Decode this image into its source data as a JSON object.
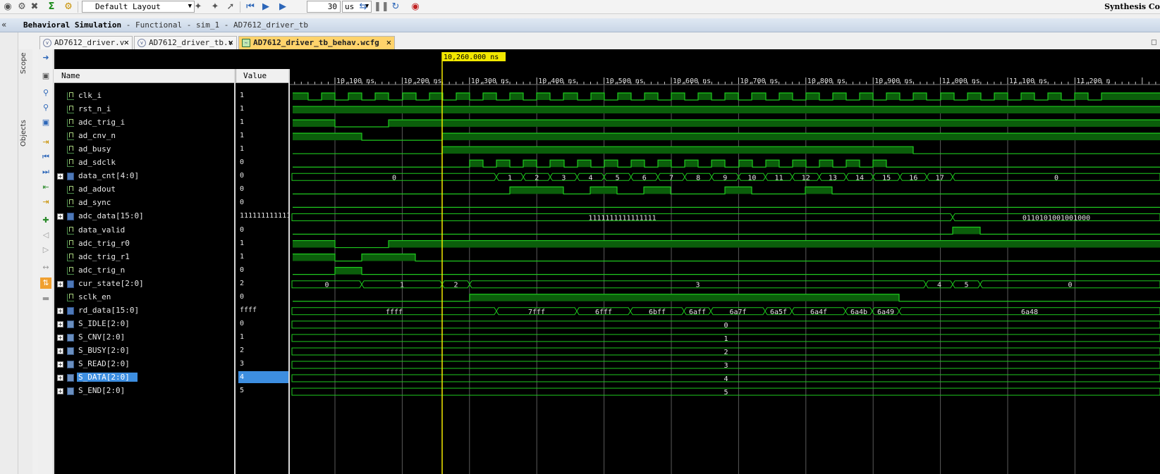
{
  "toolbar": {
    "layout": "Default Layout",
    "run_time": "30",
    "run_unit": "us",
    "right_label": "Synthesis Co"
  },
  "title_bar": {
    "title": "Behavioral Simulation",
    "subtitle": " - Functional - sim_1 - AD7612_driver_tb"
  },
  "side_tabs": [
    "Scope",
    "Objects"
  ],
  "tabs": [
    {
      "label": "AD7612_driver.v"
    },
    {
      "label": "AD7612_driver_tb.v"
    },
    {
      "label": "AD7612_driver_tb_behav.wcfg"
    }
  ],
  "waveform": {
    "name_header": "Name",
    "value_header": "Value",
    "cursor_time": "10,260.000 ns",
    "time_ticks": [
      "10,100 ns",
      "10,200 ns",
      "10,300 ns",
      "10,400 ns",
      "10,500 ns",
      "10,600 ns",
      "10,700 ns",
      "10,800 ns",
      "10,900 ns",
      "11,000 ns",
      "11,100 ns",
      "11,200 n"
    ],
    "signals": [
      {
        "name": "clk_i",
        "value": "1",
        "kind": "bit",
        "expand": false
      },
      {
        "name": "rst_n_i",
        "value": "1",
        "kind": "bit",
        "expand": false
      },
      {
        "name": "adc_trig_i",
        "value": "1",
        "kind": "bit",
        "expand": false
      },
      {
        "name": "ad_cnv_n",
        "value": "1",
        "kind": "bit",
        "expand": false
      },
      {
        "name": "ad_busy",
        "value": "1",
        "kind": "bit",
        "expand": false
      },
      {
        "name": "ad_sdclk",
        "value": "0",
        "kind": "bit",
        "expand": false
      },
      {
        "name": "data_cnt[4:0]",
        "value": "0",
        "kind": "bus",
        "expand": true
      },
      {
        "name": "ad_adout",
        "value": "0",
        "kind": "bit",
        "expand": false
      },
      {
        "name": "ad_sync",
        "value": "0",
        "kind": "bit",
        "expand": false
      },
      {
        "name": "adc_data[15:0]",
        "value": "1111111111111111",
        "kind": "bus",
        "expand": true
      },
      {
        "name": "data_valid",
        "value": "0",
        "kind": "bit",
        "expand": false
      },
      {
        "name": "adc_trig_r0",
        "value": "1",
        "kind": "bit",
        "expand": false
      },
      {
        "name": "adc_trig_r1",
        "value": "1",
        "kind": "bit",
        "expand": false
      },
      {
        "name": "adc_trig_n",
        "value": "0",
        "kind": "bit",
        "expand": false
      },
      {
        "name": "cur_state[2:0]",
        "value": "2",
        "kind": "bus",
        "expand": true
      },
      {
        "name": "sclk_en",
        "value": "0",
        "kind": "bit",
        "expand": false
      },
      {
        "name": "rd_data[15:0]",
        "value": "ffff",
        "kind": "bus",
        "expand": true
      },
      {
        "name": "S_IDLE[2:0]",
        "value": "0",
        "kind": "const",
        "expand": true
      },
      {
        "name": "S_CNV[2:0]",
        "value": "1",
        "kind": "const",
        "expand": true
      },
      {
        "name": "S_BUSY[2:0]",
        "value": "2",
        "kind": "const",
        "expand": true
      },
      {
        "name": "S_READ[2:0]",
        "value": "3",
        "kind": "const",
        "expand": true
      },
      {
        "name": "S_DATA[2:0]",
        "value": "4",
        "kind": "const",
        "expand": true,
        "selected": true
      },
      {
        "name": "S_END[2:0]",
        "value": "5",
        "kind": "const",
        "expand": true
      }
    ],
    "bus_labels": {
      "data_cnt": [
        "0",
        "1",
        "2",
        "3",
        "4",
        "5",
        "6",
        "7",
        "8",
        "9",
        "10",
        "11",
        "12",
        "13",
        "14",
        "15",
        "16",
        "17",
        "0"
      ],
      "adc_data": [
        "1111111111111111",
        "0110101001001000"
      ],
      "cur_state": [
        "0",
        "1",
        "2",
        "3",
        "4",
        "5",
        "0"
      ],
      "rd_data": [
        "ffff",
        "7fff",
        "6fff",
        "6bff",
        "6aff",
        "6a7f",
        "6a5f",
        "6a4f",
        "6a4b",
        "6a49",
        "6a48"
      ],
      "S_IDLE": [
        "0"
      ],
      "S_CNV": [
        "1"
      ],
      "S_BUSY": [
        "2"
      ],
      "S_READ": [
        "3"
      ],
      "S_DATA": [
        "4"
      ],
      "S_END": [
        "5"
      ]
    }
  },
  "colors": {
    "wave": "#1ec81e",
    "wave_fill": "#0b5e0b",
    "cursor": "#f2e800",
    "background": "#000000",
    "selection": "#3d8ee0"
  }
}
